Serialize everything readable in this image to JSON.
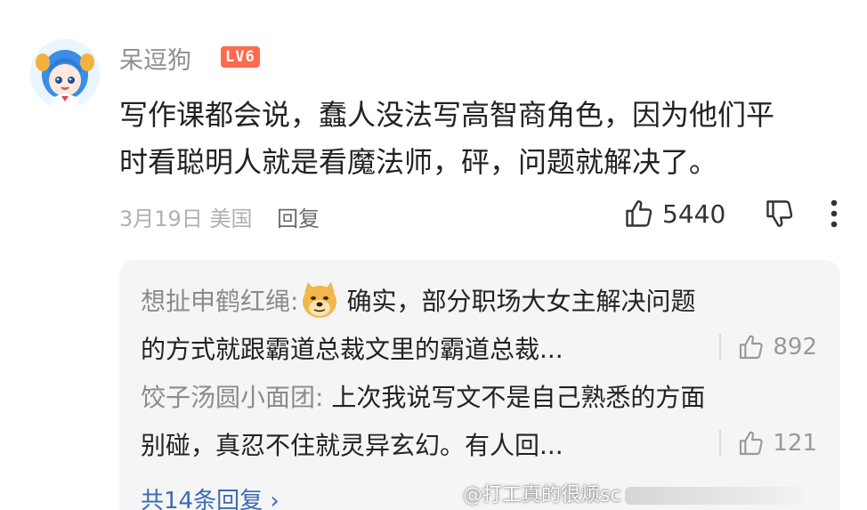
{
  "comment": {
    "username": "呆逗狗",
    "level": "LV6",
    "text_line1": "写作课都会说，蠢人没法写高智商角色，因为他们平",
    "text_line2": "时看聪明人就是看魔法师，砰，问题就解决了。",
    "date": "3月19日",
    "location": "美国",
    "reply_label": "回复",
    "likes": "5440"
  },
  "replies": [
    {
      "author": "想扯申鹤红绳:",
      "line1": "确实，部分职场大女主解决问题",
      "line2": "的方式就跟霸道总裁文里的霸道总裁...",
      "likes": "892",
      "emoji": "doge-emoji"
    },
    {
      "author": "饺子汤圆小面团:",
      "line1": "上次我说写文不是自己熟悉的方面",
      "line2": "别碰，真忍不住就灵异玄幻。有人回...",
      "likes": "121"
    }
  ],
  "total_replies": "共14条回复 ›",
  "watermark": "@打工真的很烦sc",
  "colors": {
    "level_badge": "#ff6a4d",
    "link": "#3d6bb5",
    "reply_bg": "#f5f5f5"
  }
}
